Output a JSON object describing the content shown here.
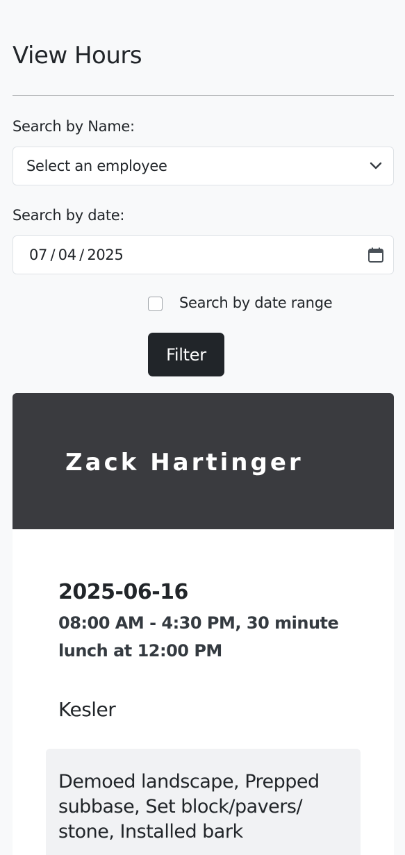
{
  "page": {
    "title": "View Hours"
  },
  "filters": {
    "name_label": "Search by Name:",
    "name_select_value": "Select an employee",
    "date_label": "Search by date:",
    "date_month": "07",
    "date_day": "04",
    "date_year": "2025",
    "range_checkbox_label": "Search by date range",
    "range_checked": false,
    "filter_button": "Filter"
  },
  "employee_card": {
    "name": "Zack Hartinger",
    "entries": [
      {
        "date": "2025-06-16",
        "time_summary": "08:00 AM - 4:30 PM, 30 minute lunch at 12:00 PM",
        "location": "Kesler",
        "notes": "Demoed landscape, Prepped subbase, Set block/pavers/ stone, Installed bark"
      }
    ]
  },
  "icons": {
    "select": "chevron-down-icon",
    "date": "calendar-icon"
  },
  "colors": {
    "background": "#f8f9fa",
    "button": "#212529",
    "card_header": "#3a3b3f"
  }
}
